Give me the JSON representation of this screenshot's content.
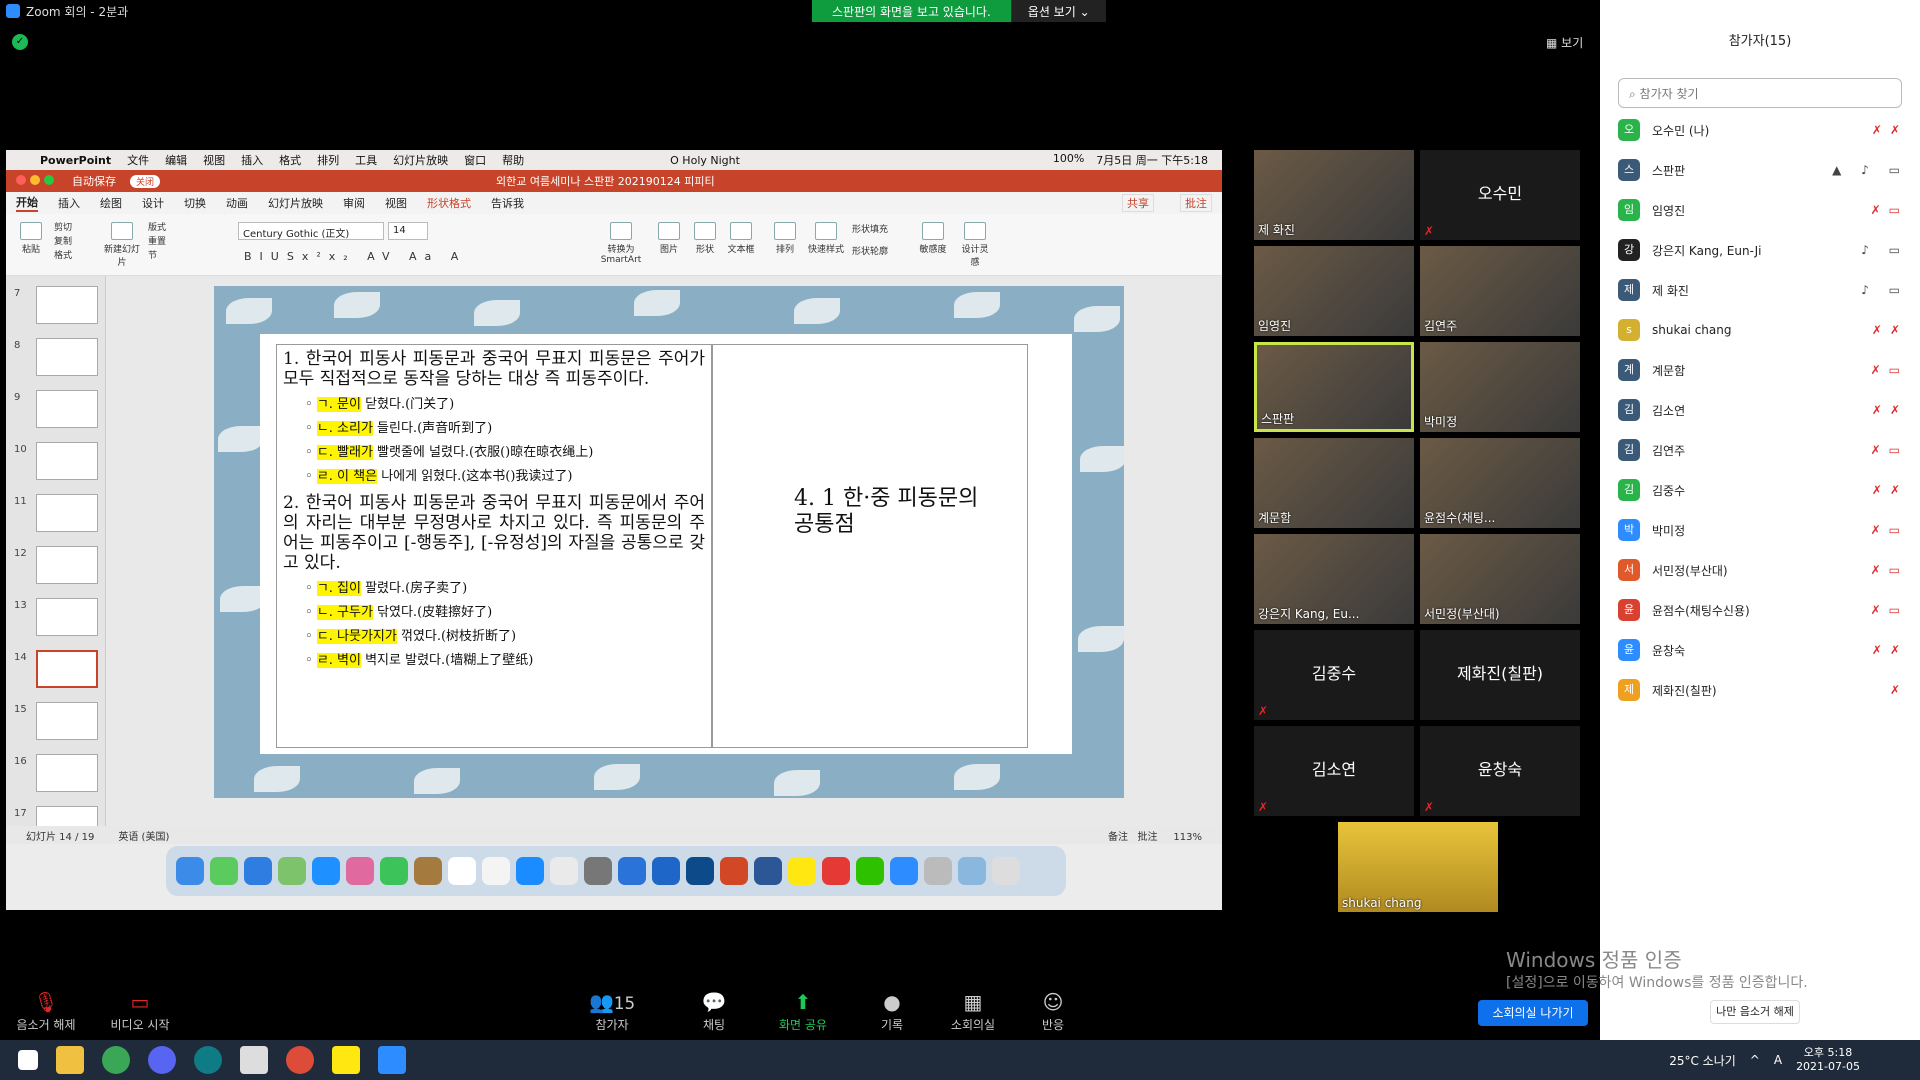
{
  "window": {
    "title": "Zoom 회의 - 2분과"
  },
  "share_banner": {
    "message": "스판판의 화면을 보고 있습니다.",
    "options": "옵션 보기"
  },
  "view_button": "보기",
  "mac_menubar": {
    "items": [
      "PowerPoint",
      "文件",
      "编辑",
      "视图",
      "插入",
      "格式",
      "排列",
      "工具",
      "幻灯片放映",
      "窗口",
      "帮助"
    ],
    "now_playing": "O Holy Night",
    "battery": "100%",
    "datetime": "7月5日 周一 下午5:18"
  },
  "ppt_titlebar": {
    "autosave": "自动保存",
    "autosave_state": "关闭",
    "doc_title": "외한교 여름세미나 스판판 202190124 피피티"
  },
  "ribbon_tabs": [
    "开始",
    "插入",
    "绘图",
    "设计",
    "切换",
    "动画",
    "幻灯片放映",
    "审阅",
    "视图",
    "形状格式",
    "告诉我"
  ],
  "ribbon_right": {
    "share": "共享",
    "comment": "批注"
  },
  "ribbon_tools": {
    "paste": "粘贴",
    "cut": "剪切",
    "copy": "复制",
    "format": "格式",
    "new_slide": "新建幻灯片",
    "layout": "版式",
    "reset": "重置",
    "section": "节",
    "font": "Century Gothic (正文)",
    "font_size": "14",
    "smartart": "转换为 SmartArt",
    "picture": "图片",
    "shape": "形状",
    "textbox": "文本框",
    "arrange": "排列",
    "quick_styles": "快速样式",
    "shape_fill": "形状填充",
    "shape_outline": "形状轮廓",
    "sensitivity": "敏感度",
    "designer": "设计灵感"
  },
  "thumbnails": [
    {
      "n": "7"
    },
    {
      "n": "8"
    },
    {
      "n": "9"
    },
    {
      "n": "10"
    },
    {
      "n": "11"
    },
    {
      "n": "12"
    },
    {
      "n": "13"
    },
    {
      "n": "14"
    },
    {
      "n": "15"
    },
    {
      "n": "16"
    },
    {
      "n": "17"
    }
  ],
  "slide": {
    "para1": "1. 한국어 피동사 피동문과 중국어 무표지 피동문은 주어가 모두 직접적으로 동작을 당하는 대상 즉 피동주이다.",
    "items1": [
      {
        "hl": "ㄱ. 문이",
        "rest": " 닫혔다.(门关了)"
      },
      {
        "hl": "ㄴ. 소리가",
        "rest": " 들린다.(声音听到了)"
      },
      {
        "hl": "ㄷ. 빨래가",
        "rest": " 빨랫줄에 널렸다.(衣服()晾在晾衣绳上)"
      },
      {
        "hl": "ㄹ. 이 책은",
        "rest": " 나에게 읽혔다.(这本书()我读过了)"
      }
    ],
    "para2": "2. 한국어 피동사 피동문과 중국어 무표지 피동문에서 주어의 자리는 대부분 무정명사로 차지고 있다. 즉 피동문의 주어는 피동주이고 [-행동주], [-유정성]의 자질을 공통으로 갖고 있다.",
    "items2": [
      {
        "hl": "ㄱ. 집이",
        "rest": " 팔렸다.(房子卖了)"
      },
      {
        "hl": "ㄴ. 구두가",
        "rest": " 닦였다.(皮鞋擦好了)"
      },
      {
        "hl": "ㄷ. 나뭇가지가",
        "rest": " 꺾였다.(树枝折断了)"
      },
      {
        "hl": "ㄹ. 벽이",
        "rest": " 벽지로 발렸다.(墙糊上了壁纸)"
      }
    ],
    "right_title": "4. 1 한·중 피동문의 공통점"
  },
  "status_bar": {
    "slide_info": "幻灯片 14 / 19",
    "language": "英语 (美国)",
    "notes": "备注",
    "comments": "批注",
    "zoom": "113%"
  },
  "gallery": [
    {
      "name": "제 화진",
      "video": true
    },
    {
      "name": "오수민",
      "video": false
    },
    {
      "name": "임영진",
      "video": true
    },
    {
      "name": "김연주",
      "video": true
    },
    {
      "name": "스판판",
      "video": true,
      "active": true
    },
    {
      "name": "박미정",
      "video": true
    },
    {
      "name": "계문함",
      "video": true
    },
    {
      "name": "윤점수(채팅...",
      "video": true
    },
    {
      "name": "강은지 Kang, Eu...",
      "video": true
    },
    {
      "name": "서민정(부산대)",
      "video": true
    },
    {
      "name": "김중수",
      "video": false
    },
    {
      "name": "제화진(칠판)",
      "video": false
    },
    {
      "name": "김소연",
      "video": false
    },
    {
      "name": "윤창숙",
      "video": false
    },
    {
      "name": "shukai chang",
      "video": true
    }
  ],
  "sidebar": {
    "title": "참가자(15)",
    "search_placeholder": "참가자 찾기",
    "participants": [
      {
        "initial": "오",
        "name": "오수민 (나)",
        "color": "#2ab34a"
      },
      {
        "initial": "스",
        "name": "스판판",
        "color": "#3a5a78"
      },
      {
        "initial": "임",
        "name": "임영진",
        "color": "#2ab34a"
      },
      {
        "initial": "강",
        "name": "강은지 Kang, Eun-Ji",
        "color": "#222222"
      },
      {
        "initial": "제",
        "name": "제 화진",
        "color": "#3a5a78"
      },
      {
        "initial": "s",
        "name": "shukai chang",
        "color": "#d4b030"
      },
      {
        "initial": "계",
        "name": "계문함",
        "color": "#3a5a78"
      },
      {
        "initial": "김",
        "name": "김소연",
        "color": "#3a5a78"
      },
      {
        "initial": "김",
        "name": "김연주",
        "color": "#3a5a78"
      },
      {
        "initial": "김",
        "name": "김중수",
        "color": "#2ab34a"
      },
      {
        "initial": "박",
        "name": "박미정",
        "color": "#2d8cff"
      },
      {
        "initial": "서",
        "name": "서민정(부산대)",
        "color": "#e0592a"
      },
      {
        "initial": "윤",
        "name": "윤점수(채팅수신용)",
        "color": "#d94030"
      },
      {
        "initial": "윤",
        "name": "윤창숙",
        "color": "#2d8cff"
      },
      {
        "initial": "제",
        "name": "제화진(칠판)",
        "color": "#f0a020"
      }
    ],
    "unmute_me": "나만 음소거 해제",
    "leave_room": "소회의실 나가기"
  },
  "watermark": {
    "line1": "Windows 정품 인증",
    "line2": "[설정]으로 이동하여 Windows를 정품 인증합니다."
  },
  "toolbar": {
    "unmute": "음소거 해제",
    "video": "비디오 시작",
    "participants": "참가자",
    "participant_count": "15",
    "chat": "채팅",
    "share": "화면 공유",
    "record": "기록",
    "breakout": "소회의실",
    "reactions": "반응"
  },
  "taskbar": {
    "weather": "25°C 소나기",
    "ime": "A",
    "time": "오후 5:18",
    "date": "2021-07-05"
  }
}
